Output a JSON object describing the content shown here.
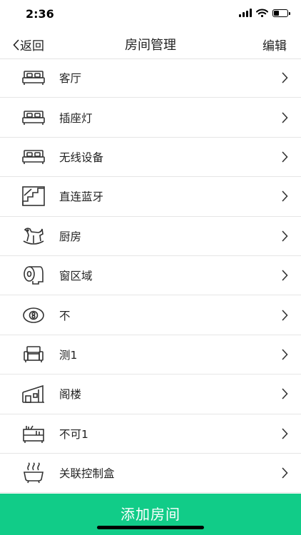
{
  "status_bar": {
    "time": "2:36",
    "battery_level": 0.45
  },
  "nav": {
    "back_label": "返回",
    "title": "房间管理",
    "edit_label": "编辑"
  },
  "rooms": [
    {
      "label": "客厅",
      "icon": "bed-icon"
    },
    {
      "label": "插座灯",
      "icon": "bed-icon"
    },
    {
      "label": "无线设备",
      "icon": "bed-icon"
    },
    {
      "label": "直连蓝牙",
      "icon": "stairs-icon"
    },
    {
      "label": "厨房",
      "icon": "rocking-horse-icon"
    },
    {
      "label": "窗区域",
      "icon": "toilet-paper-icon"
    },
    {
      "label": "不",
      "icon": "billiard-ball-icon"
    },
    {
      "label": "测1",
      "icon": "sofa-icon"
    },
    {
      "label": "阁楼",
      "icon": "attic-icon"
    },
    {
      "label": "不可1",
      "icon": "bookshelf-icon"
    },
    {
      "label": "关联控制盒",
      "icon": "bathtub-icon"
    }
  ],
  "footer": {
    "add_room_label": "添加房间"
  },
  "colors": {
    "accent": "#11cc88",
    "divider": "#e6e6e6"
  }
}
